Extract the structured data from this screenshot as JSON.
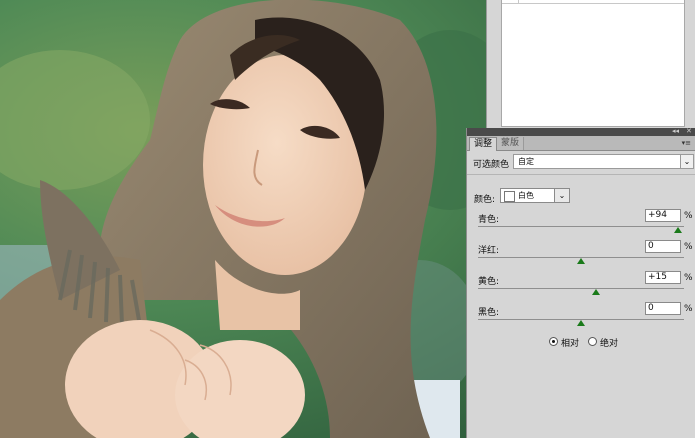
{
  "adjustments_panel": {
    "tabs": [
      {
        "label": "调整",
        "active": true
      },
      {
        "label": "蒙版",
        "active": false
      }
    ],
    "title_controls": {
      "collapse": "◂◂",
      "close": "✕"
    },
    "panel_menu_icon": "panel-menu-icon",
    "adjustment_name": "可选颜色",
    "preset": {
      "value": "自定"
    },
    "color_picker": {
      "label": "颜色:",
      "value": "白色",
      "swatch_color": "#ffffff"
    },
    "sliders": [
      {
        "label": "青色:",
        "value": "+94",
        "unit": "%",
        "level": 0.97
      },
      {
        "label": "洋红:",
        "value": "0",
        "unit": "%",
        "level": 0.5
      },
      {
        "label": "黄色:",
        "value": "+15",
        "unit": "%",
        "level": 0.575
      },
      {
        "label": "黑色:",
        "value": "0",
        "unit": "%",
        "level": 0.5
      }
    ],
    "method": {
      "options": [
        {
          "label": "相对",
          "checked": true
        },
        {
          "label": "绝对",
          "checked": false
        }
      ]
    }
  },
  "colors": {
    "panel_bg": "#d6d6d6",
    "title_bar": "#4a4a4a",
    "slider_thumb": "#1a7a1a"
  }
}
